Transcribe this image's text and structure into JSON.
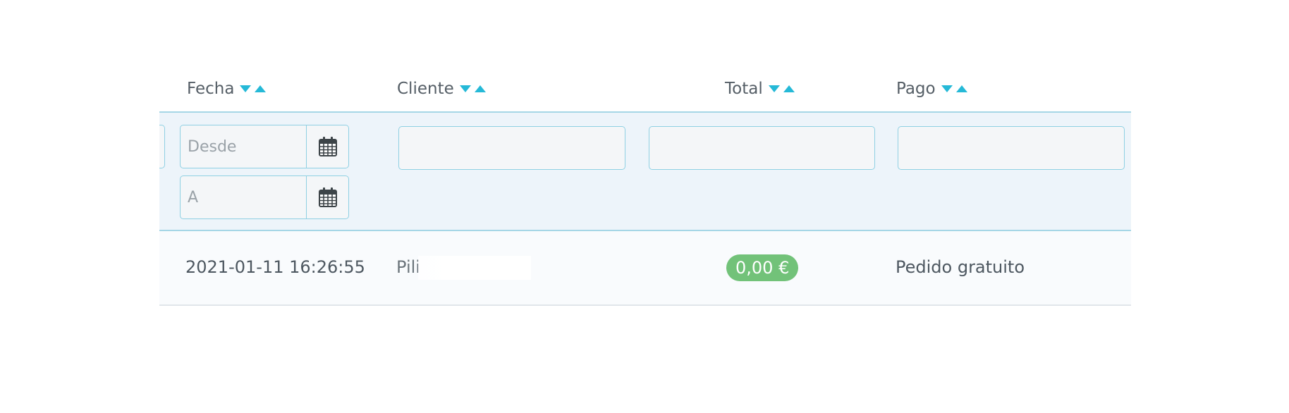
{
  "table": {
    "headers": {
      "fecha": "Fecha",
      "cliente": "Cliente",
      "total": "Total",
      "pago": "Pago"
    },
    "filters": {
      "fecha_desde_placeholder": "Desde",
      "fecha_hasta_placeholder": "A",
      "cliente_value": "",
      "total_value": "",
      "pago_value": ""
    },
    "rows": [
      {
        "fecha": "2021-01-11 16:26:55",
        "cliente": "Pili",
        "total": "0,00 €",
        "pago": "Pedido gratuito"
      }
    ]
  },
  "colors": {
    "accent": "#25b9d7",
    "filter_background": "#edf4fa",
    "input_border": "#8fd0e3",
    "badge_success": "#72c279"
  },
  "icons": {
    "sort_desc": "sort-down-icon",
    "sort_asc": "sort-up-icon",
    "calendar": "calendar-icon"
  }
}
